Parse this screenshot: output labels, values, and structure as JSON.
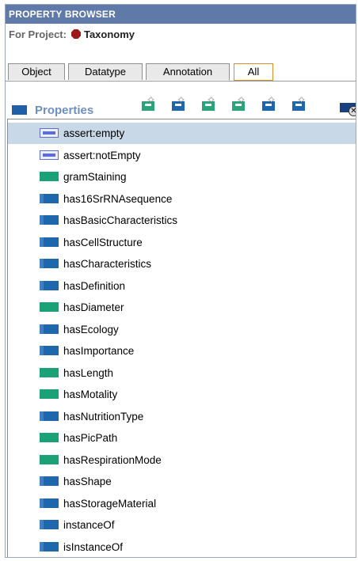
{
  "panel": {
    "title": "PROPERTY BROWSER",
    "project_label": "For Project:",
    "project_name": "Taxonomy",
    "project_icon": "ontology-hex-icon"
  },
  "tabs": [
    {
      "label": "Object",
      "active": false
    },
    {
      "label": "Datatype",
      "active": false
    },
    {
      "label": "Annotation",
      "active": false
    },
    {
      "label": "All",
      "active": true
    }
  ],
  "toolbar": {
    "heading": "Properties",
    "buttons": [
      {
        "icon": "create-property-icon",
        "color": "#2aa47a"
      },
      {
        "icon": "create-object-property-icon",
        "color": "#1e67ac"
      },
      {
        "icon": "create-subproperty-icon",
        "color": "#2aa47a"
      },
      {
        "icon": "create-datatype-property-icon",
        "color": "#2aa47a"
      },
      {
        "icon": "create-annotation-property-icon",
        "color": "#1e67ac"
      },
      {
        "icon": "create-annotation-datatype-icon",
        "color": "#1e67ac"
      },
      {
        "icon": "delete-property-icon",
        "color": "#18407e"
      }
    ]
  },
  "properties": [
    {
      "label": "assert:empty",
      "kind": "annotation",
      "selected": true
    },
    {
      "label": "assert:notEmpty",
      "kind": "annotation",
      "selected": false
    },
    {
      "label": "gramStaining",
      "kind": "datatype",
      "selected": false
    },
    {
      "label": "has16SrRNAsequence",
      "kind": "object",
      "selected": false
    },
    {
      "label": "hasBasicCharacteristics",
      "kind": "object",
      "selected": false
    },
    {
      "label": "hasCellStructure",
      "kind": "object",
      "selected": false
    },
    {
      "label": "hasCharacteristics",
      "kind": "object",
      "selected": false
    },
    {
      "label": "hasDefinition",
      "kind": "object",
      "selected": false
    },
    {
      "label": "hasDiameter",
      "kind": "datatype",
      "selected": false
    },
    {
      "label": "hasEcology",
      "kind": "object",
      "selected": false
    },
    {
      "label": "hasImportance",
      "kind": "object",
      "selected": false
    },
    {
      "label": "hasLength",
      "kind": "datatype",
      "selected": false
    },
    {
      "label": "hasMotality",
      "kind": "datatype",
      "selected": false
    },
    {
      "label": "hasNutritionType",
      "kind": "object",
      "selected": false
    },
    {
      "label": "hasPicPath",
      "kind": "datatype",
      "selected": false
    },
    {
      "label": "hasRespirationMode",
      "kind": "datatype",
      "selected": false
    },
    {
      "label": "hasShape",
      "kind": "object",
      "selected": false
    },
    {
      "label": "hasStorageMaterial",
      "kind": "object",
      "selected": false
    },
    {
      "label": "instanceOf",
      "kind": "object",
      "selected": false
    },
    {
      "label": "isInstanceOf",
      "kind": "object",
      "selected": false
    }
  ]
}
